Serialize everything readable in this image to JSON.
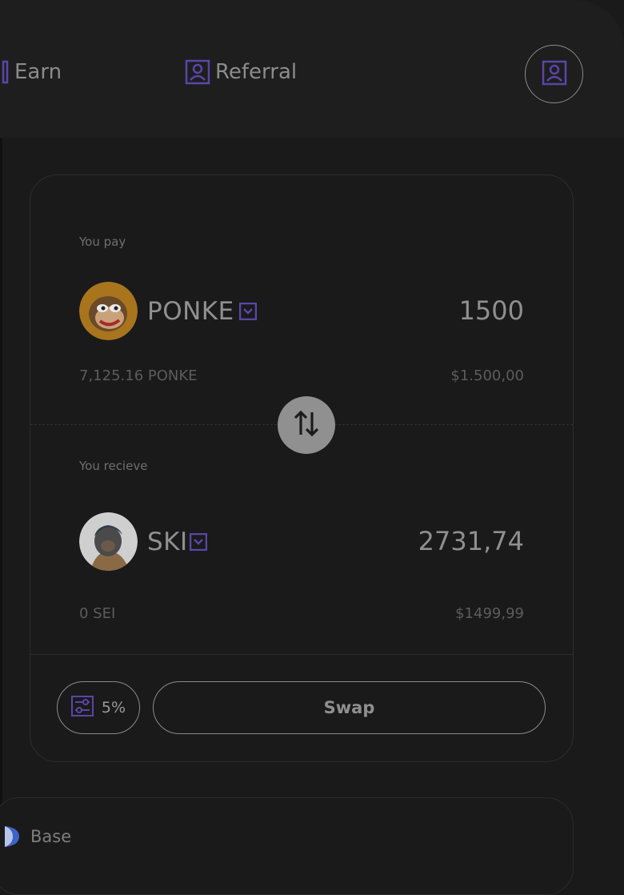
{
  "nav": {
    "earn_label": "Earn",
    "referral_label": "Referral",
    "icons": {
      "earn": "earn-icon",
      "referral": "user-frame-icon",
      "profile": "user-frame-icon"
    }
  },
  "swap": {
    "pay": {
      "label": "You pay",
      "token": "PONKE",
      "amount": "1500",
      "balance": "7,125.16 PONKE",
      "usd": "$1.500,00"
    },
    "receive": {
      "label": "You recieve",
      "token": "SKI",
      "amount": "2731,74",
      "balance": "0 SEI",
      "usd": "$1499,99"
    },
    "slippage": "5%",
    "swap_label": "Swap"
  },
  "network": {
    "label": "Base"
  },
  "colors": {
    "accent": "#5b45a8",
    "background": "#1a1a1a",
    "header": "#1e1e1e"
  }
}
